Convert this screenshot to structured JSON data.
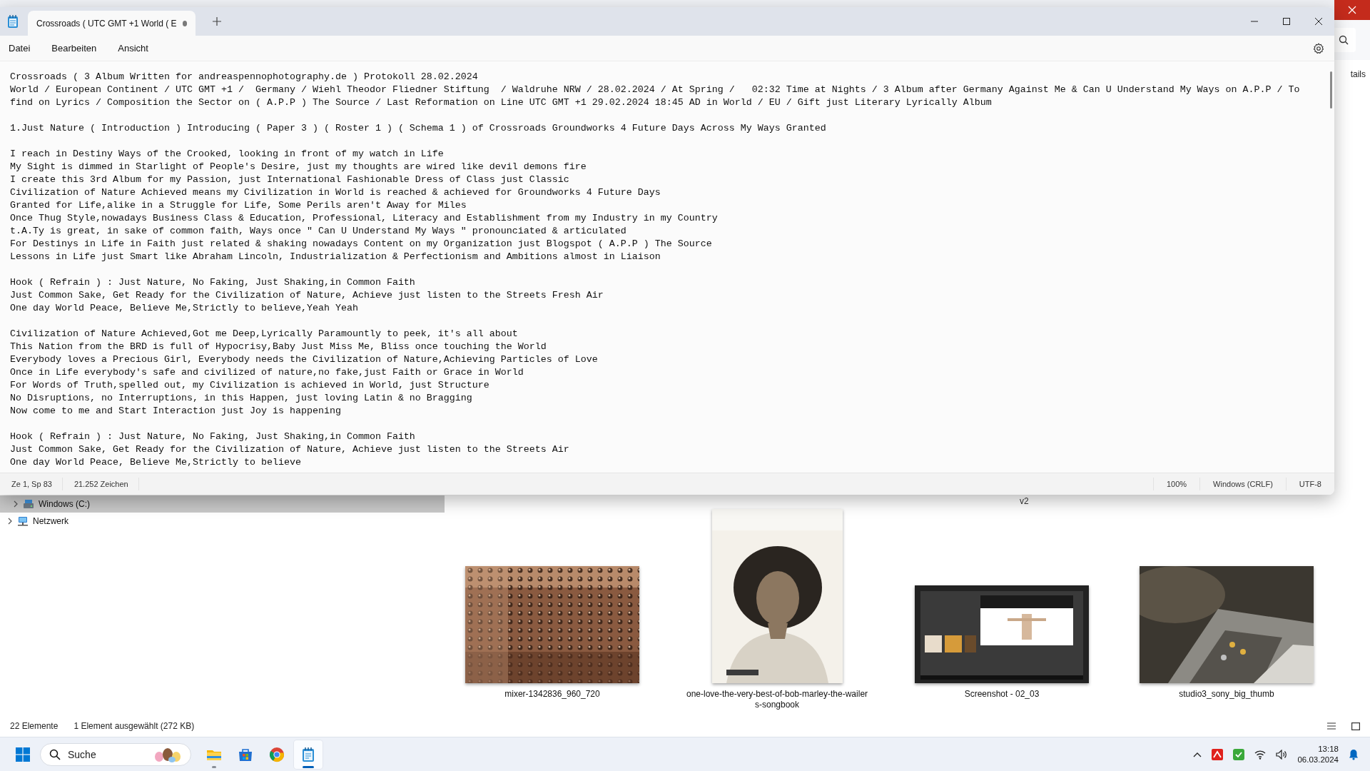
{
  "notepad": {
    "tabs": [
      {
        "title": "Crossroads ( UTC GMT +1 World ( E",
        "selected": true,
        "unsaved": true
      }
    ],
    "menu": [
      "Datei",
      "Bearbeiten",
      "Ansicht"
    ],
    "paragraphs": [
      [
        "Crossroads ( 3 Album Written for andreaspennophotography.de ) Protokoll 28.02.2024",
        "World / European Continent / UTC GMT +1 /  Germany / Wiehl Theodor Fliedner Stiftung  / Waldruhe NRW / 28.02.2024 / At Spring /   02:32 Time at Nights / 3 Album after Germany Against Me & Can U Understand My Ways on A.P.P / To",
        "find on Lyrics / Composition the Sector on ( A.P.P ) The Source / Last Reformation on Line UTC GMT +1 29.02.2024 18:45 AD in World / EU / Gift just Literary Lyrically Album"
      ],
      [
        "1.Just Nature ( Introduction ) Introducing ( Paper 3 ) ( Roster 1 ) ( Schema 1 ) of Crossroads Groundworks 4 Future Days Across My Ways Granted"
      ],
      [
        "I reach in Destiny Ways of the Crooked, looking in front of my watch in Life",
        "My Sight is dimmed in Starlight of People's Desire, just my thoughts are wired like devil demons fire",
        "I create this 3rd Album for my Passion, just International Fashionable Dress of Class just Classic",
        "Civilization of Nature Achieved means my Civilization in World is reached & achieved for Groundworks 4 Future Days",
        "Granted for Life,alike in a Struggle for Life, Some Perils aren't Away for Miles",
        "Once Thug Style,nowadays Business Class & Education, Professional, Literacy and Establishment from my Industry in my Country",
        "t.A.Ty is great, in sake of common faith, Ways once \" Can U Understand My Ways \" pronounciated & articulated",
        "For Destinys in Life in Faith just related & shaking nowadays Content on my Organization just Blogspot ( A.P.P ) The Source",
        "Lessons in Life just Smart like Abraham Lincoln, Industrialization & Perfectionism and Ambitions almost in Liaison"
      ],
      [
        "Hook ( Refrain ) : Just Nature, No Faking, Just Shaking,in Common Faith",
        "Just Common Sake, Get Ready for the Civilization of Nature, Achieve just listen to the Streets Fresh Air",
        "One day World Peace, Believe Me,Strictly to believe,Yeah Yeah"
      ],
      [
        "Civilization of Nature Achieved,Got me Deep,Lyrically Paramountly to peek, it's all about",
        "This Nation from the BRD is full of Hypocrisy,Baby Just Miss Me, Bliss once touching the World",
        "Everybody loves a Precious Girl, Everybody needs the Civilization of Nature,Achieving Particles of Love",
        "Once in Life everybody's safe and civilized of nature,no fake,just Faith or Grace in World",
        "For Words of Truth,spelled out, my Civilization is achieved in World, just Structure",
        "No Disruptions, no Interruptions, in this Happen, just loving Latin & no Bragging",
        "Now come to me and Start Interaction just Joy is happening"
      ],
      [
        "Hook ( Refrain ) : Just Nature, No Faking, Just Shaking,in Common Faith",
        "Just Common Sake, Get Ready for the Civilization of Nature, Achieve just listen to the Streets Air",
        "One day World Peace, Believe Me,Strictly to believe"
      ]
    ],
    "status_bar": {
      "position": "Ze 1, Sp 83",
      "characters": "21.252 Zeichen",
      "zoom": "100%",
      "line_endings": "Windows (CRLF)",
      "encoding": "UTF-8"
    }
  },
  "explorer": {
    "toolbar_label": "tails",
    "tree": [
      {
        "label": "Windows (C:)",
        "kind": "drive",
        "selected": true
      },
      {
        "label": "Netzwerk",
        "kind": "network",
        "selected": false
      }
    ],
    "group_label": "v2",
    "files": [
      {
        "name": "mixer-1342836_960_720",
        "kind": "mixer"
      },
      {
        "name": "one-love-the-very-best-of-bob-marley-the-wailers-songbook",
        "kind": "portrait"
      },
      {
        "name": "Screenshot - 02_03",
        "kind": "screenshot"
      },
      {
        "name": "studio3_sony_big_thumb",
        "kind": "studio"
      }
    ],
    "status_bar": {
      "count": "22 Elemente",
      "selection": "1 Element ausgewählt (272 KB)"
    }
  },
  "taskbar": {
    "search": {
      "placeholder": "Suche"
    },
    "apps": [
      {
        "kind": "explorer",
        "running": true,
        "selected": false
      },
      {
        "kind": "store",
        "running": false,
        "selected": false
      },
      {
        "kind": "chrome",
        "running": false,
        "selected": false
      },
      {
        "kind": "notepad",
        "running": true,
        "selected": true
      }
    ],
    "time": "13:18",
    "date": "06.03.2024"
  }
}
